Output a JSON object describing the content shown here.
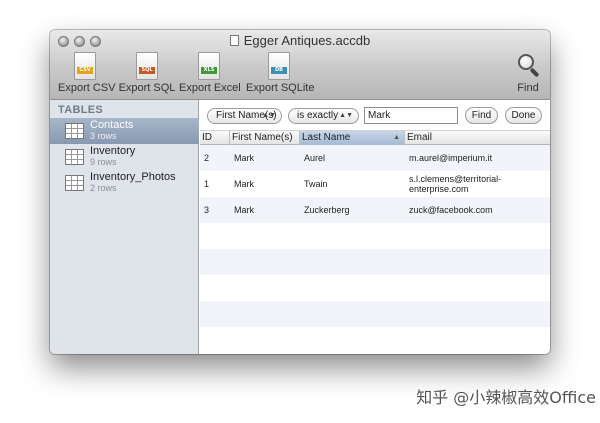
{
  "window": {
    "title": "Egger Antiques.accdb"
  },
  "toolbar": {
    "buttons": [
      {
        "label": "Export CSV",
        "tag": "CSV",
        "color": "#e6a11a"
      },
      {
        "label": "Export SQL",
        "tag": "SQL",
        "color": "#c35a1f"
      },
      {
        "label": "Export Excel",
        "tag": "XLS",
        "color": "#3f9a3a"
      },
      {
        "label": "Export SQLite",
        "tag": "DB",
        "color": "#3d8fb5"
      }
    ],
    "find_label": "Find"
  },
  "sidebar": {
    "heading": "TABLES",
    "items": [
      {
        "name": "Contacts",
        "count": "3 rows",
        "selected": true
      },
      {
        "name": "Inventory",
        "count": "9 rows",
        "selected": false
      },
      {
        "name": "Inventory_Photos",
        "count": "2 rows",
        "selected": false
      }
    ]
  },
  "filter": {
    "field": "First Name(s)",
    "operator": "is exactly",
    "value": "Mark",
    "find_label": "Find",
    "done_label": "Done"
  },
  "table": {
    "columns": [
      "ID",
      "First Name(s)",
      "Last Name",
      "Email"
    ],
    "sorted_column": "Last Name",
    "rows": [
      {
        "id": "2",
        "first": "Mark",
        "last": "Aurel",
        "email": "m.aurel@imperium.it"
      },
      {
        "id": "1",
        "first": "Mark",
        "last": "Twain",
        "email": "s.l.clemens@territorial-enterprise.com"
      },
      {
        "id": "3",
        "first": "Mark",
        "last": "Zuckerberg",
        "email": "zuck@facebook.com"
      }
    ]
  },
  "watermark": "知乎 @小辣椒高效Office"
}
